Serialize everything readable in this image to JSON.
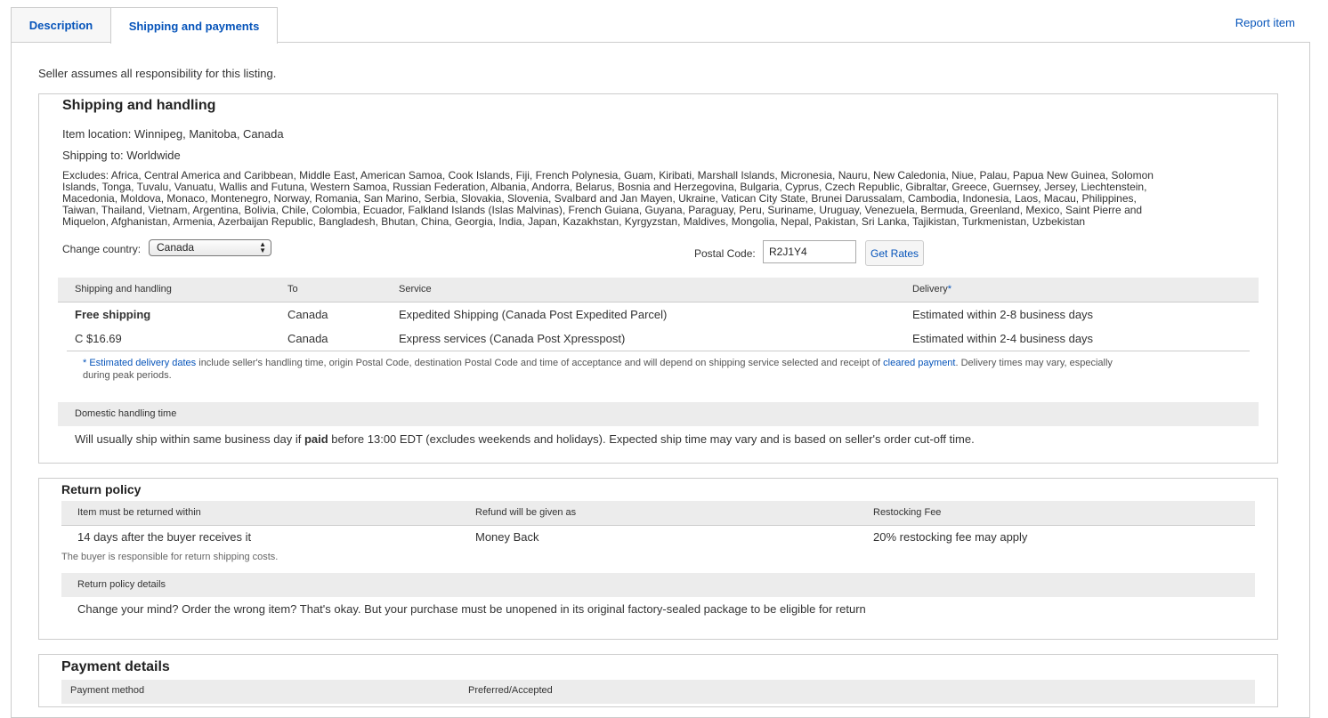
{
  "tabs": [
    {
      "label": "Description"
    },
    {
      "label": "Shipping and payments"
    }
  ],
  "report_link": "Report item",
  "seller_note": "Seller assumes all responsibility for this listing.",
  "shipping": {
    "title": "Shipping and handling",
    "item_location": "Item location: Winnipeg, Manitoba, Canada",
    "shipping_to": "Shipping to: Worldwide",
    "excludes_lines": [
      "Excludes: Africa, Central America and Caribbean, Middle East, American Samoa, Cook Islands, Fiji, French Polynesia, Guam, Kiribati, Marshall Islands, Micronesia, Nauru, New Caledonia, Niue, Palau, Papua New Guinea, Solomon",
      "Islands, Tonga, Tuvalu, Vanuatu, Wallis and Futuna, Western Samoa, Russian Federation, Albania, Andorra, Belarus, Bosnia and Herzegovina, Bulgaria, Cyprus, Czech Republic, Gibraltar, Greece, Guernsey, Jersey, Liechtenstein,",
      "Macedonia, Moldova, Monaco, Montenegro, Norway, Romania, San Marino, Serbia, Slovakia, Slovenia, Svalbard and Jan Mayen, Ukraine, Vatican City State, Brunei Darussalam, Cambodia, Indonesia, Laos, Macau, Philippines,",
      "Taiwan, Thailand, Vietnam, Argentina, Bolivia, Chile, Colombia, Ecuador, Falkland Islands (Islas Malvinas), French Guiana, Guyana, Paraguay, Peru, Suriname, Uruguay, Venezuela, Bermuda, Greenland, Mexico, Saint Pierre and",
      "Miquelon, Afghanistan, Armenia, Azerbaijan Republic, Bangladesh, Bhutan, China, Georgia, India, Japan, Kazakhstan, Kyrgyzstan, Maldives, Mongolia, Nepal, Pakistan, Sri Lanka, Tajikistan, Turkmenistan, Uzbekistan"
    ],
    "change_country_label": "Change country:",
    "country_selected": "Canada",
    "postal_code_label": "Postal Code:",
    "postal_code_value": "R2J1Y4",
    "get_rates_label": "Get Rates",
    "table_headers": {
      "handling": "Shipping and handling",
      "to": "To",
      "service": "Service",
      "delivery": "Delivery",
      "delivery_mark": "*"
    },
    "rows": [
      {
        "cost": "Free shipping",
        "to": "Canada",
        "service": "Expedited Shipping (Canada Post Expedited Parcel)",
        "delivery": "Estimated within 2-8 business days"
      },
      {
        "cost": "C $16.69",
        "to": "Canada",
        "service": "Express services (Canada Post Xpresspost)",
        "delivery": "Estimated within 2-4 business days"
      }
    ],
    "footnote": {
      "star": "* ",
      "link1": "Estimated delivery dates",
      "mid": " include seller's handling time, origin Postal Code, destination Postal Code and time of acceptance and will depend on shipping service selected and receipt of ",
      "link2": "cleared payment",
      "end": ". Delivery times may vary, especially",
      "line2": "during peak periods."
    },
    "domestic_handling_header": "Domestic handling time",
    "domestic_handling_pre": "Will usually ship within same business day if ",
    "domestic_handling_bold": "paid",
    "domestic_handling_post": " before 13:00 EDT (excludes weekends and holidays). Expected ship time may vary and is based on seller's order cut-off time."
  },
  "returns": {
    "title": "Return policy",
    "headers": {
      "within": "Item must be returned within",
      "refund": "Refund will be given as",
      "restocking": "Restocking Fee"
    },
    "within": "14 days after the buyer receives it",
    "refund": "Money Back",
    "restocking": "20% restocking fee may apply",
    "note": "The buyer is responsible for return shipping costs.",
    "details_header": "Return policy details",
    "details_text": "Change your mind? Order the wrong item? That's okay. But your purchase must be unopened in its original factory-sealed package to be eligible for return"
  },
  "payment": {
    "title": "Payment details",
    "headers": {
      "method": "Payment method",
      "preferred": "Preferred/Accepted"
    }
  },
  "colors": {
    "link_blue": "#0654ba",
    "header_grey": "#ececec",
    "border_grey": "#cccccc"
  }
}
